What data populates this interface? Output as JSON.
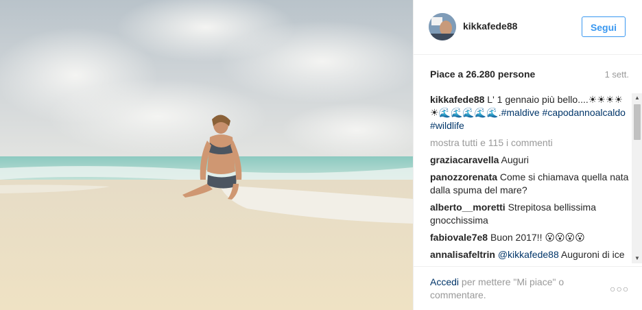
{
  "post": {
    "image_alt": "Donna in bikini seduta sulla riva di una spiaggia tropicale"
  },
  "header": {
    "username": "kikkafede88",
    "follow_label": "Segui"
  },
  "stats": {
    "likes": "Piace a 26.280 persone",
    "time": "1 sett."
  },
  "caption": {
    "username": "kikkafede88",
    "text": "L' 1 gennaio più bello....☀☀☀☀☀🌊🌊🌊🌊🌊.",
    "hashtags": [
      "#maldive",
      "#capodannoalcaldo",
      "#wildlife"
    ]
  },
  "comments": {
    "more_label": "mostra tutti e 115 i commenti",
    "items": [
      {
        "user": "graziacaravella",
        "text": "Auguri"
      },
      {
        "user": "panozzorenata",
        "text": "Come si chiamava quella nata dalla spuma del mare?"
      },
      {
        "user": "alberto__moretti",
        "text": "Strepitosa bellissima gnocchissima"
      },
      {
        "user": "fabiovale7e8",
        "text": "Buon 2017!! 😮😮😮😮"
      },
      {
        "user": "annalisafeltrin",
        "mention": "@kikkafede88",
        "text": "Auguroni di ice dal vento italiane"
      }
    ]
  },
  "footer": {
    "login_link": "Accedi",
    "login_text": "per mettere \"Mi piace\" o commentare.",
    "more_options": "○○○"
  },
  "colors": {
    "accent": "#3897f0",
    "link": "#003569",
    "muted": "#999999"
  }
}
